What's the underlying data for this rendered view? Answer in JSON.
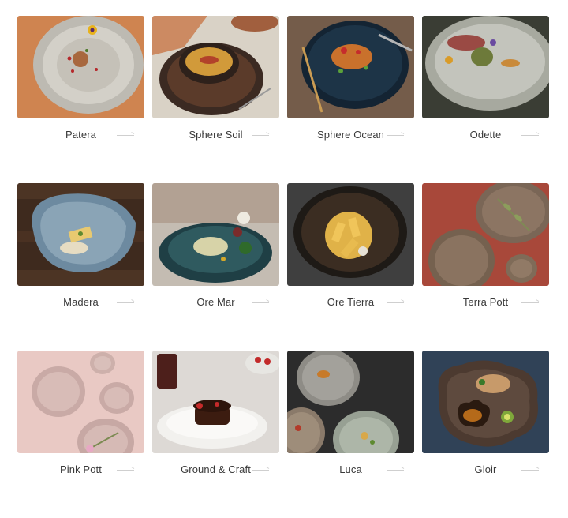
{
  "collections": [
    {
      "name": "Patera",
      "icon": "arrow-right-icon"
    },
    {
      "name": "Sphere Soil",
      "icon": "arrow-right-icon"
    },
    {
      "name": "Sphere Ocean",
      "icon": "arrow-right-icon"
    },
    {
      "name": "Odette",
      "icon": "arrow-right-icon"
    },
    {
      "name": "Madera",
      "icon": "arrow-right-icon"
    },
    {
      "name": "Ore Mar",
      "icon": "arrow-right-icon"
    },
    {
      "name": "Ore Tierra",
      "icon": "arrow-right-icon"
    },
    {
      "name": "Terra Pott",
      "icon": "arrow-right-icon"
    },
    {
      "name": "Pink Pott",
      "icon": "arrow-right-icon"
    },
    {
      "name": "Ground & Craft",
      "icon": "arrow-right-icon"
    },
    {
      "name": "Luca",
      "icon": "arrow-right-icon"
    },
    {
      "name": "Gloir",
      "icon": "arrow-right-icon"
    }
  ],
  "colors": {
    "caption_text": "#3a3a3a",
    "arrow": "#cfcfcf",
    "background": "#ffffff"
  }
}
